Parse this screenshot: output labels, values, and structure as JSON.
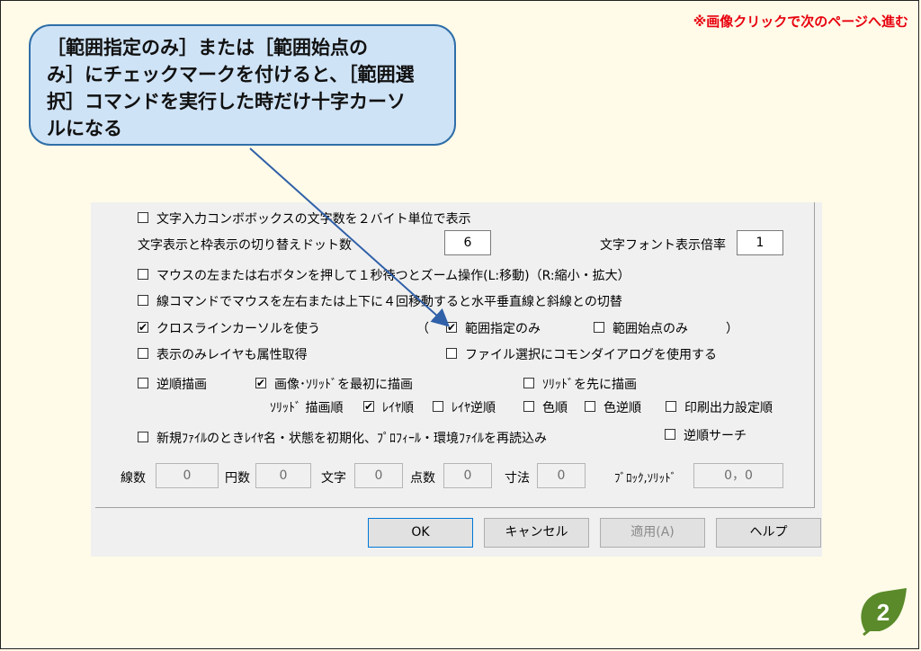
{
  "page_note": "※画像クリックで次のページへ進む",
  "callout": {
    "lines": [
      "［範囲指定のみ］または［範囲始点の",
      "み］にチェックマークを付けると、［範囲選",
      "択］コマンドを実行した時だけ十字カーソ",
      "ルになる"
    ]
  },
  "dialog": {
    "opt_2byte": {
      "label": "文字入力コンボボックスの文字数を２バイト単位で表示",
      "checked": false
    },
    "dot_switch": {
      "label": "文字表示と枠表示の切り替えドット数",
      "value": "6"
    },
    "font_ratio": {
      "label": "文字フォント表示倍率",
      "value": "1"
    },
    "mouse_zoom": {
      "label": "マウスの左または右ボタンを押して１秒待つとズーム操作(L:移動)（R:縮小・拡大）",
      "checked": false
    },
    "line_switch": {
      "label": "線コマンドでマウスを左右または上下に４回移動すると水平垂直線と斜線との切替",
      "checked": false
    },
    "crossline": {
      "label": "クロスラインカーソルを使う",
      "checked": true
    },
    "paren_open": "（",
    "paren_close": "）",
    "range_only": {
      "label": "範囲指定のみ",
      "checked": true
    },
    "range_start_only": {
      "label": "範囲始点のみ",
      "checked": false
    },
    "display_layer_attr": {
      "label": "表示のみレイヤも属性取得",
      "checked": false
    },
    "common_dialog": {
      "label": "ファイル選択にコモンダイアログを使用する",
      "checked": false
    },
    "reverse_draw": {
      "label": "逆順描画",
      "checked": false
    },
    "image_solid_first": {
      "label": "画像･ｿﾘｯﾄﾞを最初に描画",
      "checked": true
    },
    "solid_first": {
      "label": "ｿﾘｯﾄﾞを先に描画",
      "checked": false
    },
    "solid_order_label": "ｿﾘｯﾄﾞ 描画順",
    "layer_order": {
      "label": "ﾚｲﾔ順",
      "checked": true
    },
    "layer_reverse": {
      "label": "ﾚｲﾔ逆順",
      "checked": false
    },
    "color_order": {
      "label": "色順",
      "checked": false
    },
    "color_reverse": {
      "label": "色逆順",
      "checked": false
    },
    "print_order": {
      "label": "印刷出力設定順",
      "checked": false
    },
    "new_file_init": {
      "label": "新規ﾌｧｲﾙのときﾚｲﾔ名・状態を初期化、ﾌﾟﾛﾌｨｰﾙ・環境ﾌｧｲﾙを再読込み",
      "checked": false
    },
    "reverse_search": {
      "label": "逆順サーチ",
      "checked": false
    },
    "stats": {
      "lines_label": "線数",
      "lines_value": "0",
      "circles_label": "円数",
      "circles_value": "0",
      "text_label": "文字",
      "text_value": "0",
      "points_label": "点数",
      "points_value": "0",
      "dims_label": "寸法",
      "dims_value": "0",
      "block_label": "ﾌﾞﾛｯｸ,ｿﾘｯﾄﾞ",
      "block_value": "0，0"
    },
    "buttons": {
      "ok": "OK",
      "cancel": "キャンセル",
      "apply": "適用(A)",
      "help": "ヘルプ"
    }
  },
  "page_number": "2",
  "colors": {
    "note": "#e8000e",
    "bubble_fill": "#cfe3f6",
    "bubble_border": "#2f6ea8",
    "badge": "#5a8a2a",
    "background": "#fffbe8"
  }
}
